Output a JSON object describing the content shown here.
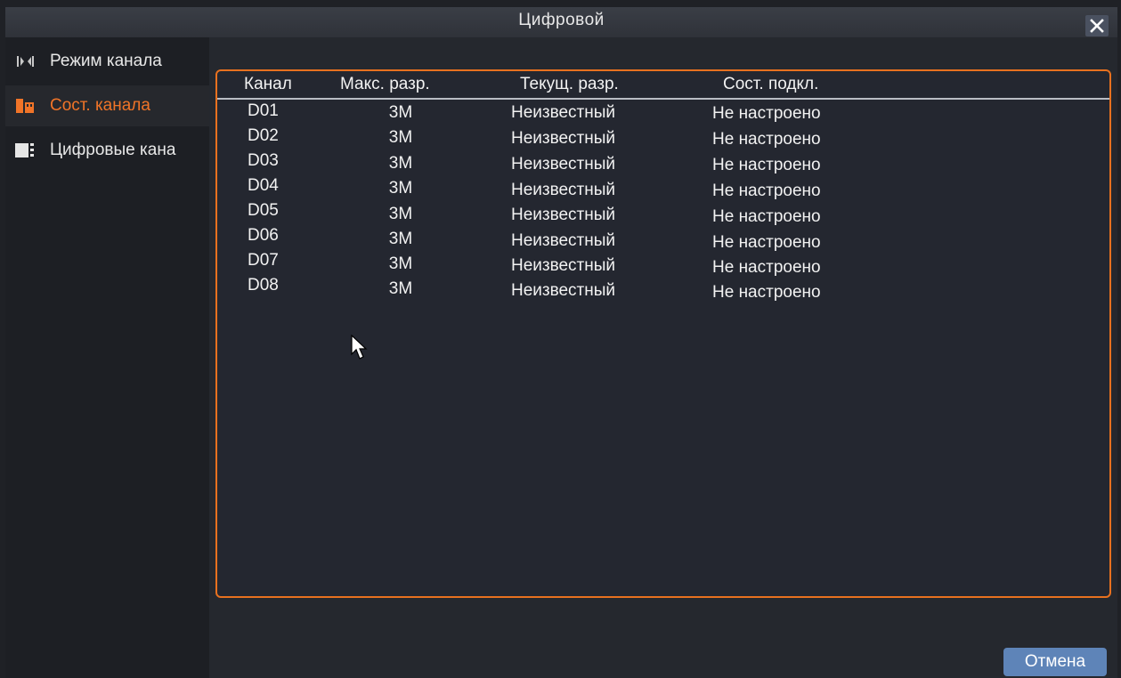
{
  "window": {
    "title": "Цифровой",
    "close_icon": "close-icon"
  },
  "sidebar": {
    "items": [
      {
        "label": "Режим канала",
        "icon": "channel-mode-icon",
        "active": false
      },
      {
        "label": "Сост. канала",
        "icon": "channel-status-icon",
        "active": true
      },
      {
        "label": "Цифровые кана",
        "icon": "digital-channels-icon",
        "active": false
      }
    ]
  },
  "table": {
    "headers": [
      "Канал",
      "Макс. разр.",
      "Текущ. разр.",
      "Сост. подкл."
    ],
    "rows": [
      [
        "D01",
        "3M",
        "Неизвестный",
        "Не настроено"
      ],
      [
        "D02",
        "3M",
        "Неизвестный",
        "Не настроено"
      ],
      [
        "D03",
        "3M",
        "Неизвестный",
        "Не настроено"
      ],
      [
        "D04",
        "3M",
        "Неизвестный",
        "Не настроено"
      ],
      [
        "D05",
        "3M",
        "Неизвестный",
        "Не настроено"
      ],
      [
        "D06",
        "3M",
        "Неизвестный",
        "Не настроено"
      ],
      [
        "D07",
        "3M",
        "Неизвестный",
        "Не настроено"
      ],
      [
        "D08",
        "3M",
        "Неизвестный",
        "Не настроено"
      ]
    ]
  },
  "footer": {
    "cancel_label": "Отмена"
  },
  "colors": {
    "accent": "#f07428",
    "panel_border": "#e8711f",
    "button": "#5e84b8",
    "background": "#25282e"
  }
}
